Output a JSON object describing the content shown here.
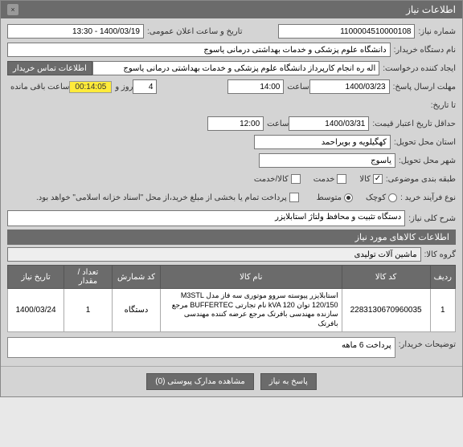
{
  "window": {
    "title": "اطلاعات نیاز"
  },
  "fields": {
    "need_no_label": "شماره نیاز:",
    "need_no": "1100004510000108",
    "announce_label": "تاریخ و ساعت اعلان عمومی:",
    "announce": "1400/03/19 - 13:30",
    "buyer_label": "نام دستگاه خریدار:",
    "buyer": "دانشگاه علوم پزشکی و خدمات بهداشتی درمانی یاسوج",
    "creator_label": "ایجاد کننده درخواست:",
    "creator": "اله ره انجام کارپرداز دانشگاه علوم پزشکی و خدمات بهداشتی درمانی یاسوج",
    "contact_btn": "اطلاعات تماس خریدار",
    "deadline_send_label": "مهلت ارسال پاسخ:",
    "deadline_date": "1400/03/23",
    "time_label": "ساعت",
    "deadline_time": "14:00",
    "and_label": "و",
    "day_label": "روز و",
    "remain_days": "4",
    "timer": "00:14:05",
    "remain_label": "ساعت باقی مانده",
    "until_label": "تا تاریخ:",
    "min_valid_label": "حداقل تاریخ اعتبار قیمت:",
    "min_valid_date": "1400/03/31",
    "min_valid_time": "12:00",
    "province_label": "استان محل تحویل:",
    "province": "کهگیلویه و بویراحمد",
    "city_label": "شهر محل تحویل:",
    "city": "یاسوج",
    "budget_label": "طبقه بندی موضوعی:",
    "opt_goods": "کالا",
    "opt_service": "خدمت",
    "opt_goods_service": "کالا/خدمت",
    "process_label": "نوع فرآیند خرید :",
    "opt_small": "کوچک",
    "opt_medium": "متوسط",
    "payment_note": "پرداخت تمام یا بخشی از مبلغ خرید،از محل \"اسناد خزانه اسلامی\" خواهد بود.",
    "desc_label": "شرح کلی نیاز:",
    "desc": "دستگاه تثبیت و محافظ ولتاژ استابلایزر"
  },
  "section_items": "اطلاعات کالاهای مورد نیاز",
  "group_label": "گروه کالا:",
  "group_value": "ماشین آلات تولیدی",
  "table": {
    "headers": [
      "ردیف",
      "کد کالا",
      "نام کالا",
      "کد شمارش",
      "تعداد / مقدار",
      "تاریخ نیاز"
    ],
    "rows": [
      {
        "idx": "1",
        "code": "2283130670960035",
        "name": "استابلایزر پیوسته سروو موتوری سه فاز مدل M3STL 120/150 توان kVA 120 نام تجارتی BUFFERTEC مرجع سازنده مهندسی بافرتک مرجع عرضه کننده مهندسی بافرتک",
        "unit": "دستگاه",
        "qty": "1",
        "date": "1400/03/24"
      }
    ]
  },
  "buyer_notes_label": "توضیحات خریدار:",
  "buyer_notes": "پرداخت 6 ماهه",
  "footer": {
    "attach_btn": "مشاهده مدارک پیوستی (0)",
    "reply_btn": "پاسخ به نیاز"
  }
}
